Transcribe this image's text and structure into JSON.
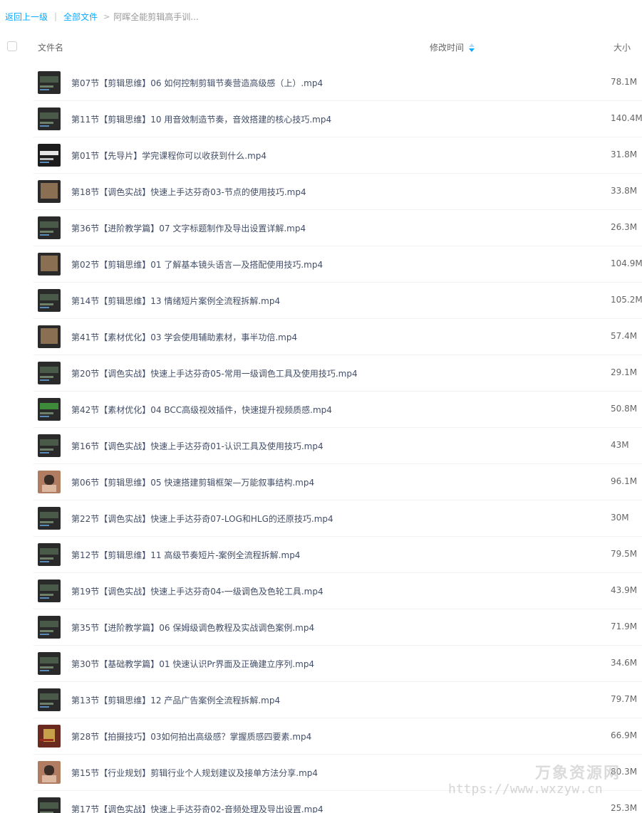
{
  "breadcrumb": {
    "back": "返回上一级",
    "separator": "|",
    "all_files": "全部文件",
    "arrow": ">",
    "current": "阿晖全能剪辑高手训..."
  },
  "header": {
    "name": "文件名",
    "modified": "修改时间",
    "size": "大小"
  },
  "files": [
    {
      "name": "第07节【剪辑思维】06 如何控制剪辑节奏营造高级感（上）.mp4",
      "size": "78.1M",
      "thumb": "timeline-icon"
    },
    {
      "name": "第11节【剪辑思维】10 用音效制造节奏，音效搭建的核心技巧.mp4",
      "size": "140.4M",
      "thumb": "timeline-icon"
    },
    {
      "name": "第01节【先导片】学完课程你可以收获到什么.mp4",
      "size": "31.8M",
      "thumb": "bw-title-icon"
    },
    {
      "name": "第18节【调色实战】快速上手达芬奇03-节点的使用技巧.mp4",
      "size": "33.8M",
      "thumb": "video-frame-icon"
    },
    {
      "name": "第36节【进阶教学篇】07 文字标题制作及导出设置详解.mp4",
      "size": "26.3M",
      "thumb": "timeline-icon"
    },
    {
      "name": "第02节【剪辑思维】01 了解基本镜头语言—及搭配使用技巧.mp4",
      "size": "104.9M",
      "thumb": "video-frame-icon"
    },
    {
      "name": "第14节【剪辑思维】13 情绪短片案例全流程拆解.mp4",
      "size": "105.2M",
      "thumb": "timeline-icon"
    },
    {
      "name": "第41节【素材优化】03 学会使用辅助素材，事半功倍.mp4",
      "size": "57.4M",
      "thumb": "video-frame-icon"
    },
    {
      "name": "第20节【调色实战】快速上手达芬奇05-常用一级调色工具及使用技巧.mp4",
      "size": "29.1M",
      "thumb": "timeline-icon"
    },
    {
      "name": "第42节【素材优化】04 BCC高级视效插件，快速提升视频质感.mp4",
      "size": "50.8M",
      "thumb": "green-plugin-icon"
    },
    {
      "name": "第16节【调色实战】快速上手达芬奇01-认识工具及使用技巧.mp4",
      "size": "43M",
      "thumb": "timeline-icon"
    },
    {
      "name": "第06节【剪辑思维】05 快速搭建剪辑框架—万能叙事结构.mp4",
      "size": "96.1M",
      "thumb": "presenter-face-icon"
    },
    {
      "name": "第22节【调色实战】快速上手达芬奇07-LOG和HLG的还原技巧.mp4",
      "size": "30M",
      "thumb": "timeline-icon"
    },
    {
      "name": "第12节【剪辑思维】11 高级节奏短片-案例全流程拆解.mp4",
      "size": "79.5M",
      "thumb": "timeline-icon"
    },
    {
      "name": "第19节【调色实战】快速上手达芬奇04-一级调色及色轮工具.mp4",
      "size": "43.9M",
      "thumb": "timeline-icon"
    },
    {
      "name": "第35节【进阶教学篇】06 保姆级调色教程及实战调色案例.mp4",
      "size": "71.9M",
      "thumb": "timeline-icon"
    },
    {
      "name": "第30节【基础教学篇】01 快速认识Pr界面及正确建立序列.mp4",
      "size": "34.6M",
      "thumb": "timeline-icon"
    },
    {
      "name": "第13节【剪辑思维】12 产品广告案例全流程拆解.mp4",
      "size": "79.7M",
      "thumb": "timeline-icon"
    },
    {
      "name": "第28节【拍摄技巧】03如何拍出高级感？掌握质感四要素.mp4",
      "size": "66.9M",
      "thumb": "red-scene-icon"
    },
    {
      "name": "第15节【行业规划】剪辑行业个人规划建议及接单方法分享.mp4",
      "size": "80.3M",
      "thumb": "presenter-face-icon"
    },
    {
      "name": "第17节【调色实战】快速上手达芬奇02-音频处理及导出设置.mp4",
      "size": "25.3M",
      "thumb": "timeline-icon"
    }
  ],
  "watermark": {
    "title": "万象资源网",
    "url": "https://www.wxzyw.cn"
  }
}
